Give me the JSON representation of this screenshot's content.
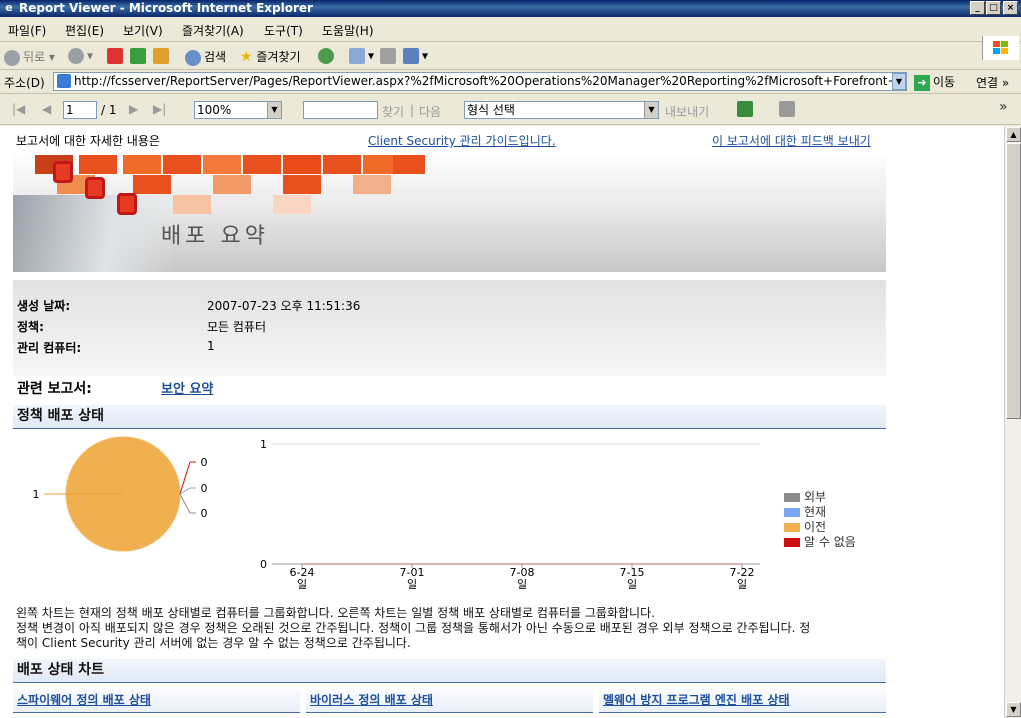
{
  "window": {
    "title": "Report Viewer - Microsoft Internet Explorer"
  },
  "menu": [
    "파일(F)",
    "편집(E)",
    "보기(V)",
    "즐겨찾기(A)",
    "도구(T)",
    "도움말(H)"
  ],
  "toolbar": {
    "back": "뒤로",
    "search": "검색",
    "favorites": "즐겨찾기"
  },
  "address": {
    "label": "주소(D)",
    "url": "http://fcsserver/ReportServer/Pages/ReportViewer.aspx?%2fMicrosoft%20Operations%20Manager%20Reporting%2fMicrosoft+Forefront+Client+Sec",
    "go": "이동",
    "links": "연결"
  },
  "report_toolbar": {
    "page": "1",
    "of": "/ 1",
    "zoom": "100%",
    "find": "찾기",
    "sep": "|",
    "next": "다음",
    "format_placeholder": "형식 선택",
    "export": "내보내기"
  },
  "report": {
    "details_label": "보고서에 대한 자세한 내용은",
    "guide_link": "Client Security 관리 가이드입니다.",
    "feedback_link": "이 보고서에 대한 피드백 보내기",
    "title": "배포 요약",
    "info": [
      {
        "label": "생성 날짜:",
        "value": "2007-07-23 오후 11:51:36"
      },
      {
        "label": "정책:",
        "value": "모든 컴퓨터"
      },
      {
        "label": "관리 컴퓨터:",
        "value": "1"
      }
    ],
    "related_label": "관련 보고서:",
    "related_link": "보안 요약",
    "section1": "정책 배포 상태",
    "description": [
      "왼쪽 차트는 현재의 정책 배포 상태별로 컴퓨터를 그룹화합니다. 오른쪽 차트는 일별 정책 배포 상태별로 컴퓨터를 그룹화합니다.",
      "정책 변경이 아직 배포되지 않은 경우 정책은 오래된 것으로 간주됩니다. 정책이 그룹 정책을 통해서가 아닌 수동으로 배포된 경우 외부 정책으로 간주됩니다. 정",
      "책이 Client Security 관리 서버에 없는 경우 알 수 없는 정책으로 간주됩니다."
    ],
    "section2": "배포 상태 차트",
    "subsections": [
      "스파이웨어 정의 배포 상태",
      "바이러스 정의 배포 상태",
      "멜웨어 방지 프로그램 엔진 배포 상태"
    ]
  },
  "colors": {
    "outside": "#8c8c8c",
    "current": "#7aa7f0",
    "previous": "#f0b050",
    "unknown": "#cc1010"
  },
  "chart_data": [
    {
      "type": "pie",
      "labels": [
        "이전",
        "외부",
        "현재",
        "알 수 없음"
      ],
      "values": [
        1,
        0,
        0,
        0
      ],
      "data_labels": [
        "1",
        "0",
        "0",
        "0"
      ]
    },
    {
      "type": "line",
      "categories": [
        "6-24",
        "7-01",
        "7-08",
        "7-15",
        "7-22"
      ],
      "category_sub": [
        "일",
        "일",
        "일",
        "일",
        "일"
      ],
      "y_ticks": [
        "1",
        "0"
      ],
      "ylim": [
        0,
        1
      ],
      "series": [
        {
          "name": "외부",
          "values": [
            0,
            0,
            0,
            0,
            0
          ]
        },
        {
          "name": "현재",
          "values": [
            0,
            0,
            0,
            0,
            0
          ]
        },
        {
          "name": "이전",
          "values": [
            0,
            0,
            0,
            0,
            0
          ]
        },
        {
          "name": "알 수 없음",
          "values": [
            0,
            0,
            0,
            0,
            0
          ]
        }
      ],
      "legend": [
        "외부",
        "현재",
        "이전",
        "알 수 없음"
      ],
      "legend_position": "right"
    }
  ]
}
